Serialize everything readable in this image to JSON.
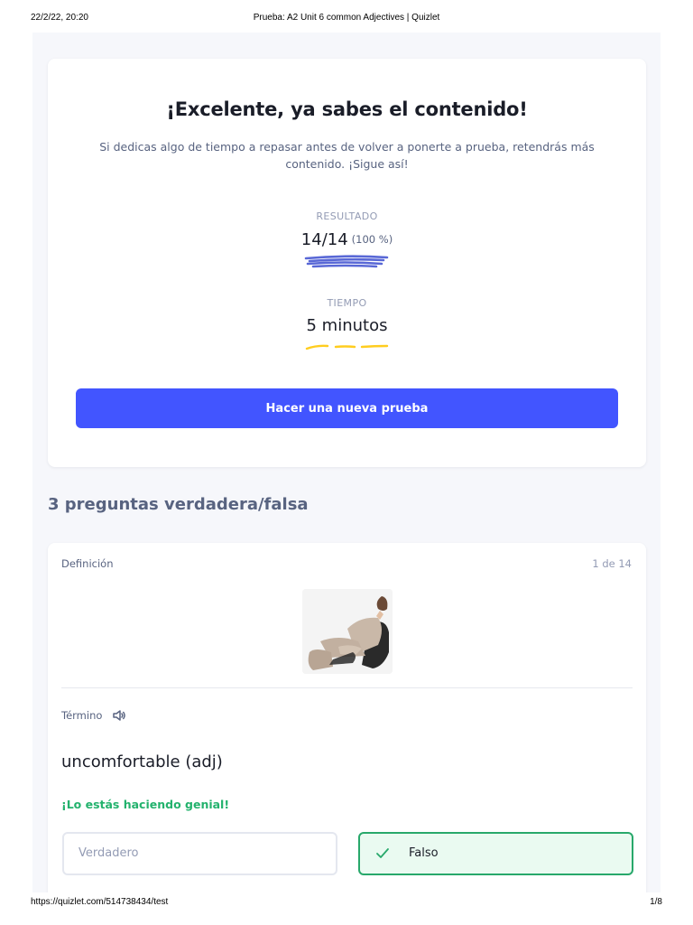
{
  "print_header": {
    "datetime": "22/2/22, 20:20",
    "title": "Prueba: A2 Unit 6 common Adjectives | Quizlet"
  },
  "print_footer": {
    "url": "https://quizlet.com/514738434/test",
    "page": "1/8"
  },
  "result": {
    "title": "¡Excelente, ya sabes el contenido!",
    "subtitle": "Si dedicas algo de tiempo a repasar antes de volver a ponerte a prueba, retendrás más contenido. ¡Sigue así!",
    "score_label": "RESULTADO",
    "score_value": "14/14",
    "score_percent": "(100 %)",
    "time_label": "TIEMPO",
    "time_value": "5 minutos",
    "new_test_button": "Hacer una nueva prueba"
  },
  "section": {
    "heading": "3 preguntas verdadera/falsa"
  },
  "question": {
    "definition_label": "Definición",
    "counter": "1 de 14",
    "term_label": "Término",
    "term": "uncomfortable (adj)",
    "feedback": "¡Lo estás haciendo genial!",
    "option_true": "Verdadero",
    "option_false": "Falso",
    "selected_option": "Falso"
  },
  "icons": {
    "speaker": "speaker-icon",
    "check": "check-icon"
  },
  "colors": {
    "primary_button": "#4255ff",
    "score_scribble": "#5968d6",
    "time_scribble": "#ffcd1f",
    "success": "#23b26d"
  }
}
